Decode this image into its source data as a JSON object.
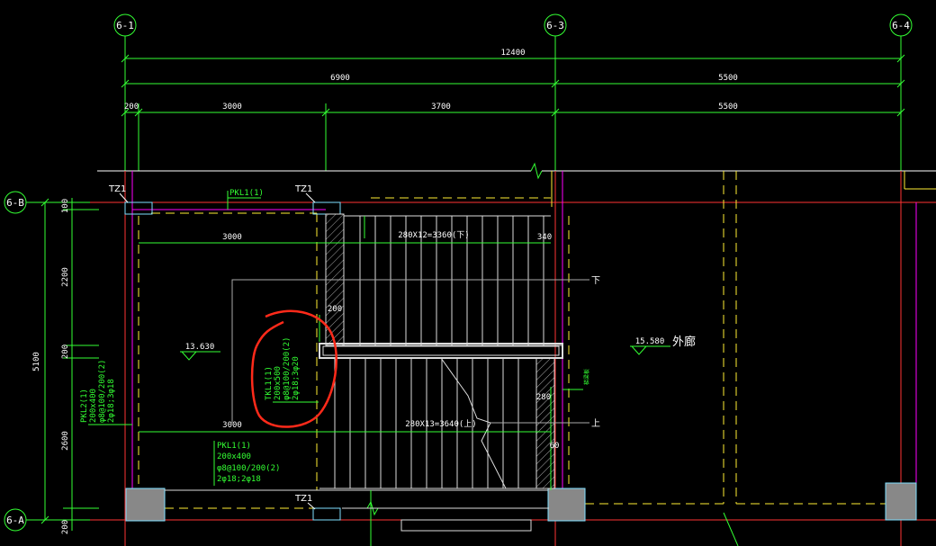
{
  "axes": {
    "top": [
      "6-1",
      "6-3",
      "6-4"
    ],
    "left": [
      "6-B",
      "6-A"
    ]
  },
  "dims": {
    "overall": "12400",
    "row2": [
      "6900",
      "5500"
    ],
    "row3": [
      "200",
      "3000",
      "3700",
      "5500"
    ],
    "left_total": "5100",
    "left_parts": [
      "100",
      "2200",
      "200",
      "2600",
      "200"
    ],
    "inner_3000_top": "3000",
    "inner_3000_bot": "3000",
    "d_340": "340",
    "d_200a": "200",
    "d_280": "280",
    "d_60": "60"
  },
  "labels": {
    "tz1_a": "TZ1",
    "tz1_b": "TZ1",
    "tz1_c": "TZ1",
    "pkl1_top": "PKL1(1)",
    "stair_up_top": "280X12=3360(下)",
    "stair_up_bot": "280X13=3640(上)",
    "down": "下",
    "up": "上",
    "elev_left": "13.630",
    "elev_right": "15.580",
    "corridor": "外廊",
    "small_green": "梯梁板"
  },
  "beams": {
    "tkl1": [
      "TKL1(1)",
      "200x500",
      "φ8@100/200(2)",
      "2φ18;3φ20"
    ],
    "pkl2": [
      "PKL2(1)",
      "200x400",
      "φ8@100/200(2)",
      "2φ18;3φ18"
    ],
    "pkl1": [
      "PKL1(1)",
      "200x400",
      "φ8@100/200(2)",
      "2φ18;2φ18"
    ]
  },
  "colors": {
    "axis_line": "#ff3333",
    "dim_line": "#33ff33",
    "wall": "#ffff55",
    "beam": "#ff00ff",
    "column": "#7fdfff",
    "cloud": "#ff2a1a"
  }
}
